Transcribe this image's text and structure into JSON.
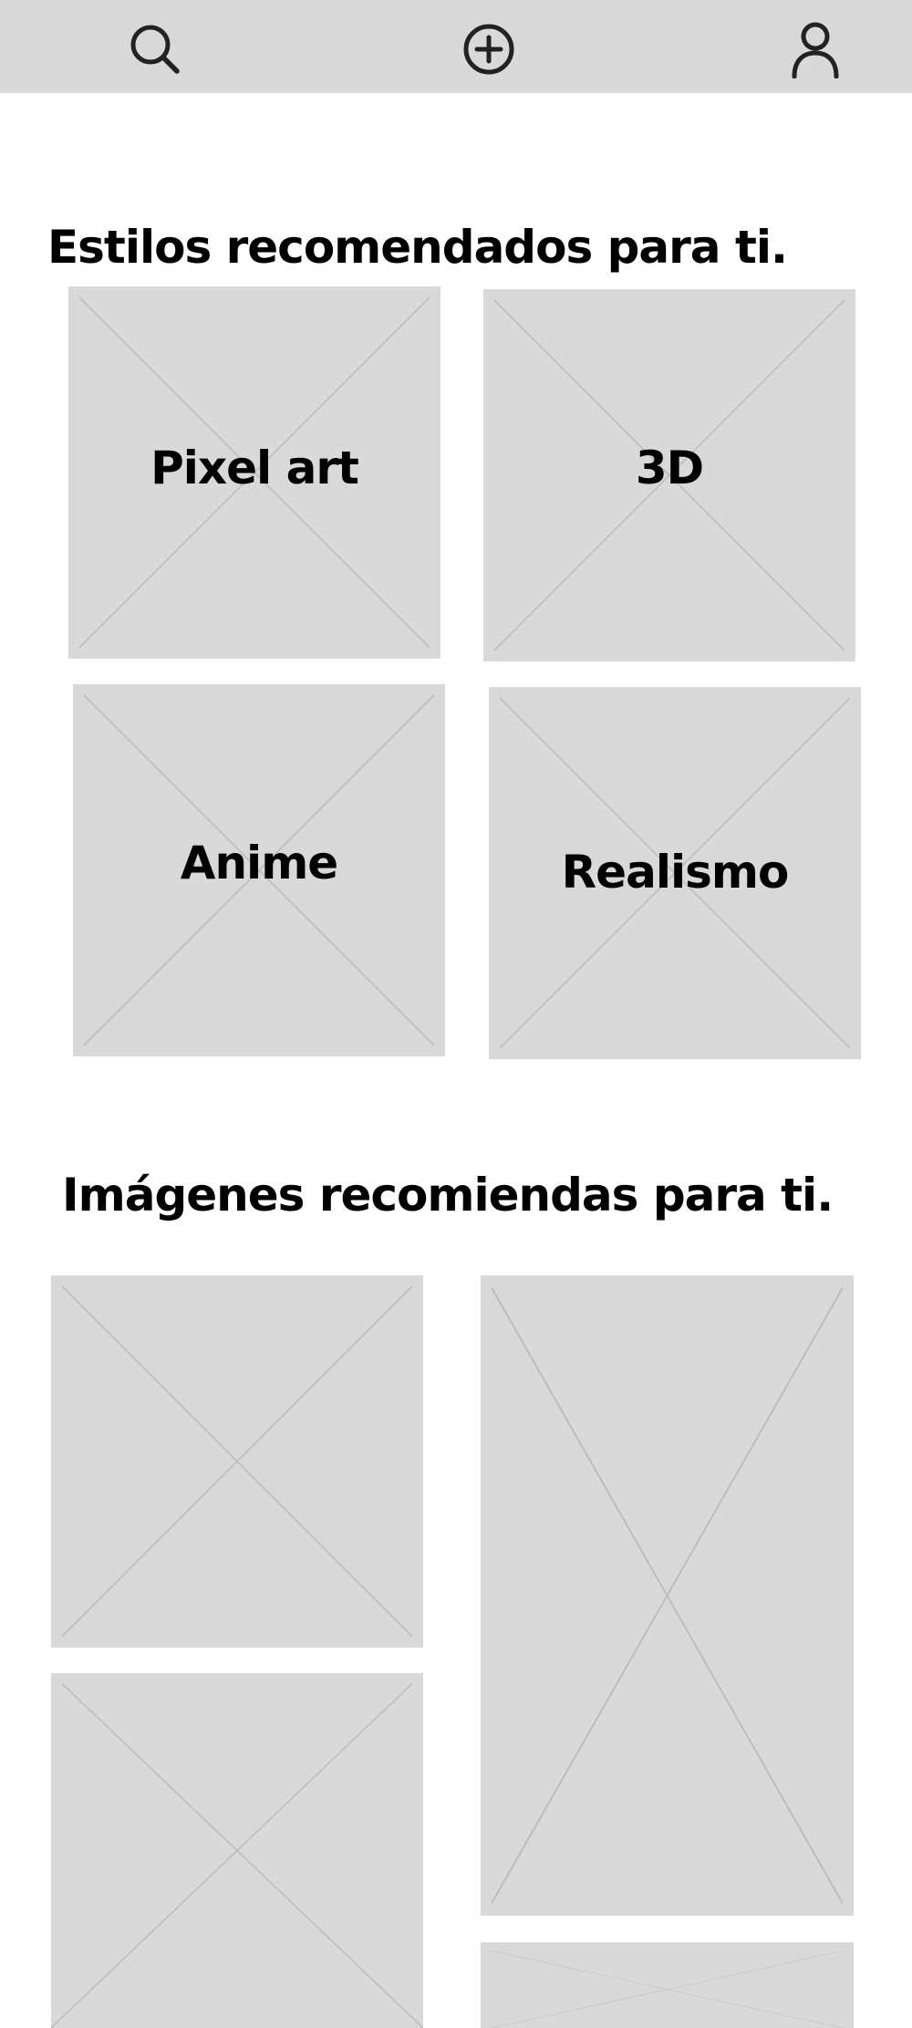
{
  "nav": {
    "items": [
      {
        "id": "search",
        "icon": "search-icon"
      },
      {
        "id": "create",
        "icon": "plus-circle-icon"
      },
      {
        "id": "profile",
        "icon": "user-icon"
      }
    ]
  },
  "styles_section": {
    "title": "Estilos recomendados para ti.",
    "items": [
      {
        "label": "Pixel art"
      },
      {
        "label": "3D"
      },
      {
        "label": "Anime"
      },
      {
        "label": "Realismo"
      }
    ]
  },
  "images_section": {
    "title": "Imágenes recomiendas para ti."
  },
  "colors": {
    "bar": "#d9d9d9",
    "placeholder": "#d9d9d9",
    "placeholder_line": "#bdbdbd",
    "text": "#000000",
    "icon": "#222222"
  }
}
